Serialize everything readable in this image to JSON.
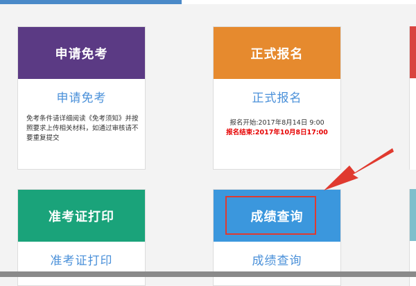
{
  "colors": {
    "purple": "#5b3a84",
    "orange": "#e68a2e",
    "green": "#1aa37a",
    "blue": "#3b97dd",
    "red_edge": "#d9443f",
    "teal_edge": "#7fbfcc",
    "link_blue": "#4a90d9",
    "highlight_red": "#e03a2f"
  },
  "cards": {
    "exempt": {
      "header": "申请免考",
      "title": "申请免考",
      "body": "免考条件请详细阅读《免考须知》并按照要求上传相关材料，如通过审核请不要重复提交"
    },
    "register": {
      "header": "正式报名",
      "title": "正式报名",
      "start": "报名开始:2017年8月14日 9:00",
      "end": "报名结束:2017年10月8日17:00"
    },
    "admission": {
      "header": "准考证打印",
      "title": "准考证打印"
    },
    "score": {
      "header": "成绩查询",
      "title": "成绩查询"
    }
  },
  "icons": {
    "pointer": "red-arrow-icon"
  }
}
